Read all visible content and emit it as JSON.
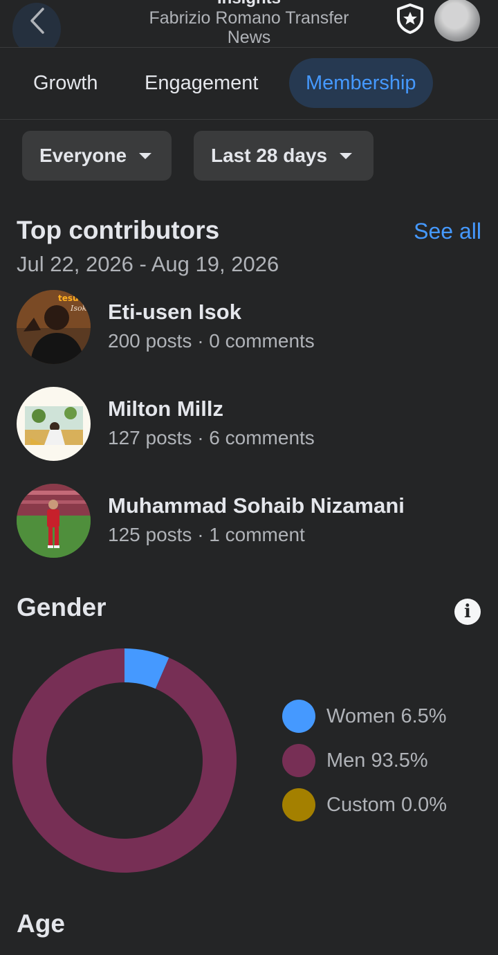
{
  "header": {
    "title": "Insights",
    "subtitle_line1": "Fabrizio Romano Transfer",
    "subtitle_line2": "News"
  },
  "tabs": [
    {
      "label": "Growth",
      "active": false
    },
    {
      "label": "Engagement",
      "active": false
    },
    {
      "label": "Membership",
      "active": true
    }
  ],
  "filters": {
    "audience": "Everyone",
    "period": "Last 28 days"
  },
  "top_contributors": {
    "title": "Top contributors",
    "see_all": "See all",
    "date_range": "Jul 22, 2026 - Aug 19, 2026",
    "items": [
      {
        "name": "Eti-usen Isok",
        "stats": "200 posts · 0 comments",
        "avatar_caption": "Isok"
      },
      {
        "name": "Milton Millz",
        "stats": "127 posts · 6 comments"
      },
      {
        "name": "Muhammad Sohaib Nizamani",
        "stats": "125 posts · 1 comment"
      }
    ]
  },
  "gender": {
    "title": "Gender",
    "legend": [
      {
        "label": "Women 6.5%",
        "color": "#4599ff"
      },
      {
        "label": "Men 93.5%",
        "color": "#772f55"
      },
      {
        "label": "Custom 0.0%",
        "color": "#a48000"
      }
    ]
  },
  "chart_data": {
    "type": "pie",
    "categories": [
      "Women",
      "Men",
      "Custom"
    ],
    "values": [
      6.5,
      93.5,
      0.0
    ],
    "colors": [
      "#4599ff",
      "#772f55",
      "#a48000"
    ],
    "title": "Gender"
  },
  "age": {
    "title": "Age"
  }
}
